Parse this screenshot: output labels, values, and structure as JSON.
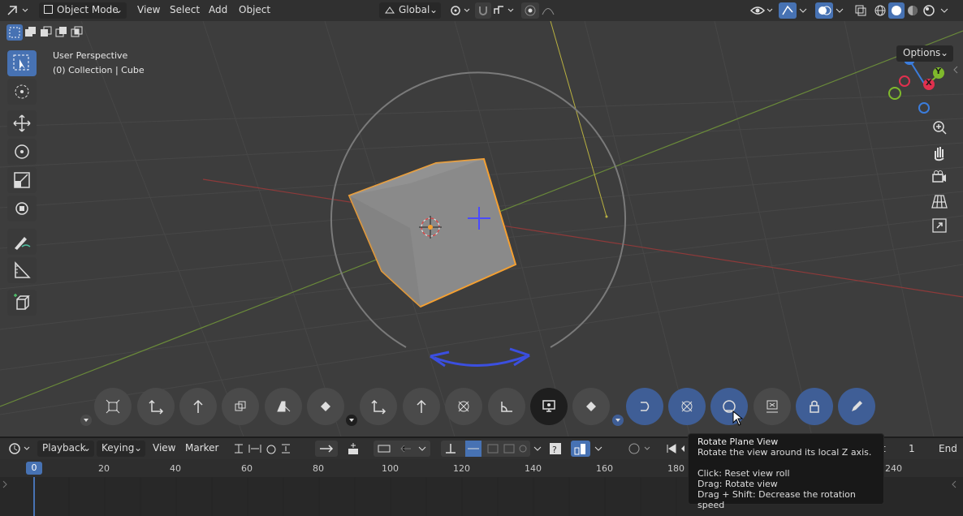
{
  "header": {
    "mode": "Object Mode",
    "menus": [
      "View",
      "Select",
      "Add",
      "Object"
    ],
    "transform_orientation": "Global"
  },
  "viewport": {
    "perspective_label": "User Perspective",
    "collection_label": "(0) Collection | Cube",
    "options_label": "Options",
    "gizmo": {
      "z": "Z",
      "y": "Y",
      "x": "X"
    }
  },
  "timeline": {
    "menus": [
      "Playback",
      "Keying",
      "View",
      "Marker"
    ],
    "current_frame": "0",
    "ticks": [
      "20",
      "40",
      "60",
      "80",
      "100",
      "120",
      "140",
      "160",
      "180",
      "240"
    ],
    "start_label": "t",
    "start_value": "1",
    "end_label": "End"
  },
  "tooltip": {
    "title": "Rotate Plane View",
    "description": "Rotate the view around its local Z axis.",
    "line1": "Click: Reset view roll",
    "line2": "Drag: Rotate view",
    "line3": "Drag + Shift: Decrease the rotation speed"
  },
  "colors": {
    "accent": "#4772b3",
    "selection_outline": "#f5a031",
    "x_axis": "#e0304e",
    "y_axis": "#7fb92c",
    "z_axis": "#3b7ddd"
  }
}
